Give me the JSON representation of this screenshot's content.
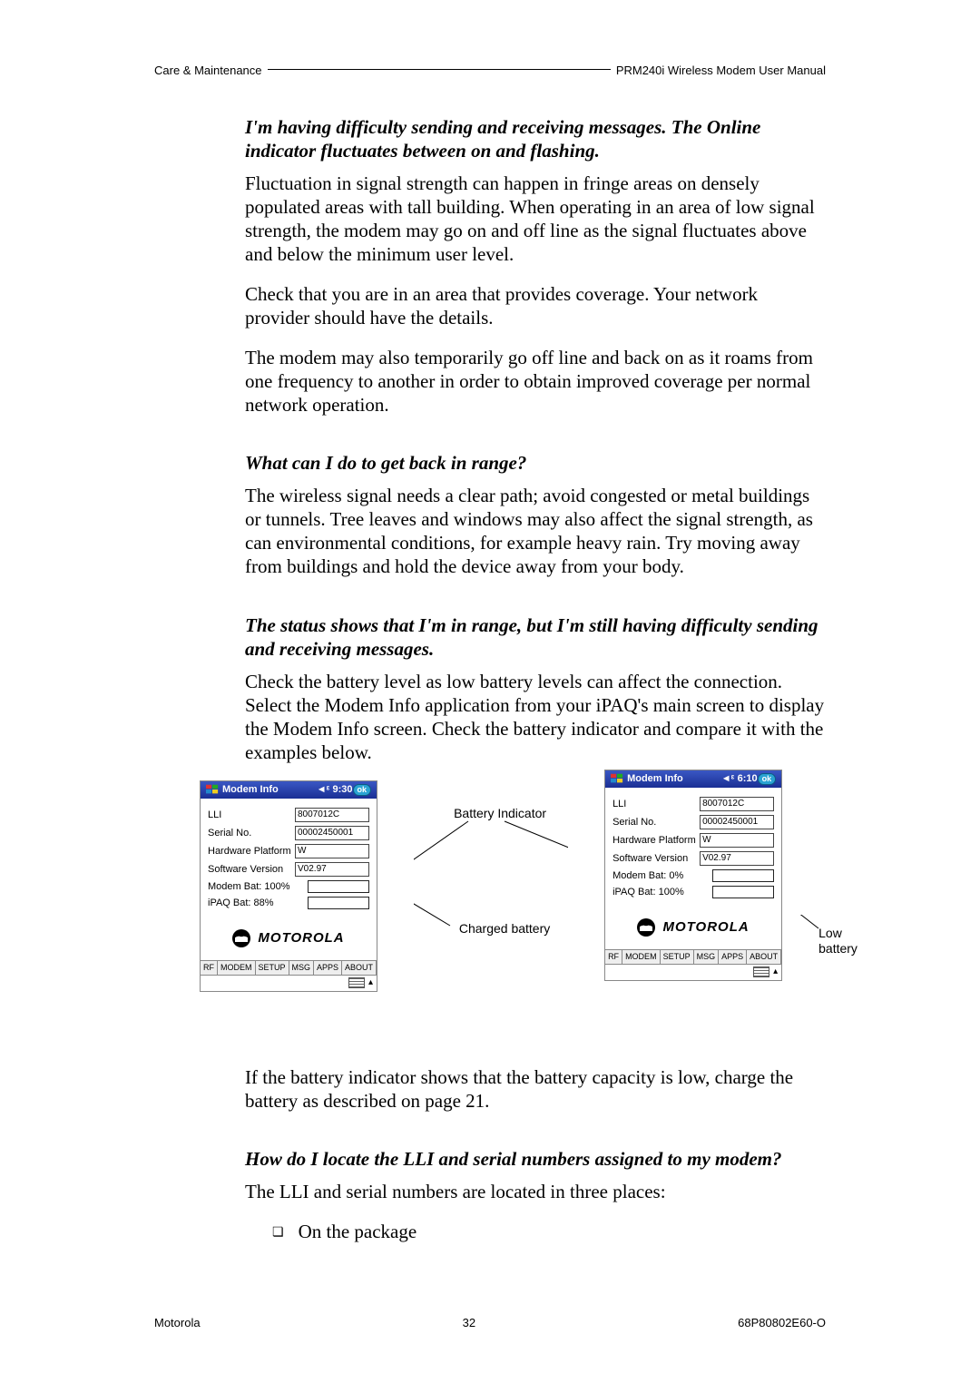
{
  "header": {
    "left": "Care & Maintenance",
    "right": "PRM240i Wireless Modem User Manual"
  },
  "sections": {
    "s1": {
      "heading": "I'm having difficulty sending and receiving messages. The Online indicator fluctuates between on and flashing.",
      "p1": "Fluctuation in signal strength can happen in fringe areas on densely populated areas with tall building. When operating in an area of low signal strength, the modem may go on and off line as the signal fluctuates above and below the minimum user level.",
      "p2": "Check that you are in an area that provides coverage. Your network provider should have the details.",
      "p3": "The modem may also temporarily go off line and back on as it roams from one frequency to another in order to obtain improved coverage per normal network operation."
    },
    "s2": {
      "heading": "What can I do to get back in range?",
      "p1": "The wireless signal needs a clear path; avoid congested or metal buildings or tunnels. Tree leaves and windows may also affect the signal strength, as can environmental conditions, for example heavy rain. Try moving away from buildings and hold the device away from your body."
    },
    "s3": {
      "heading": "The status shows that I'm in range, but I'm still having difficulty sending and receiving messages.",
      "p1": "Check the battery level as low battery levels can affect the connection. Select the Modem Info application from your iPAQ's main screen to display the Modem Info screen. Check the battery indicator and compare it with the examples below.",
      "p2": "If the battery indicator shows that the battery capacity is low, charge the battery as described on page 21."
    },
    "s4": {
      "heading": "How do I locate the LLI and serial numbers assigned to my modem?",
      "p1": "The LLI and serial numbers are located in three places:",
      "li1": "On the package"
    }
  },
  "annotations": {
    "battery_indicator": "Battery Indicator",
    "charged": "Charged battery",
    "low": "Low battery"
  },
  "screens": {
    "left": {
      "title": "Modem Info",
      "time": "◄ᵋ 9:30",
      "ok": "ok",
      "lli_label": "LLI",
      "lli": "8007012C",
      "serial_label": "Serial No.",
      "serial": "00002450001",
      "hw_label": "Hardware Platform",
      "hw": "W",
      "sw_label": "Software Version",
      "sw": "V02.97",
      "modem_bat": "Modem Bat: 100%",
      "ipaq_bat": "iPAQ Bat: 88%",
      "brand": "MOTOROLA",
      "tabs": [
        "RF",
        "MODEM",
        "SETUP",
        "MSG",
        "APPS",
        "ABOUT"
      ]
    },
    "right": {
      "title": "Modem Info",
      "time": "◄ᵋ 6:10",
      "ok": "ok",
      "lli_label": "LLI",
      "lli": "8007012C",
      "serial_label": "Serial No.",
      "serial": "00002450001",
      "hw_label": "Hardware Platform",
      "hw": "W",
      "sw_label": "Software Version",
      "sw": "V02.97",
      "modem_bat": "Modem Bat: 0%",
      "ipaq_bat": "iPAQ Bat: 100%",
      "brand": "MOTOROLA",
      "tabs": [
        "RF",
        "MODEM",
        "SETUP",
        "MSG",
        "APPS",
        "ABOUT"
      ]
    }
  },
  "footer": {
    "left": "Motorola",
    "center": "32",
    "right": "68P80802E60-O"
  }
}
